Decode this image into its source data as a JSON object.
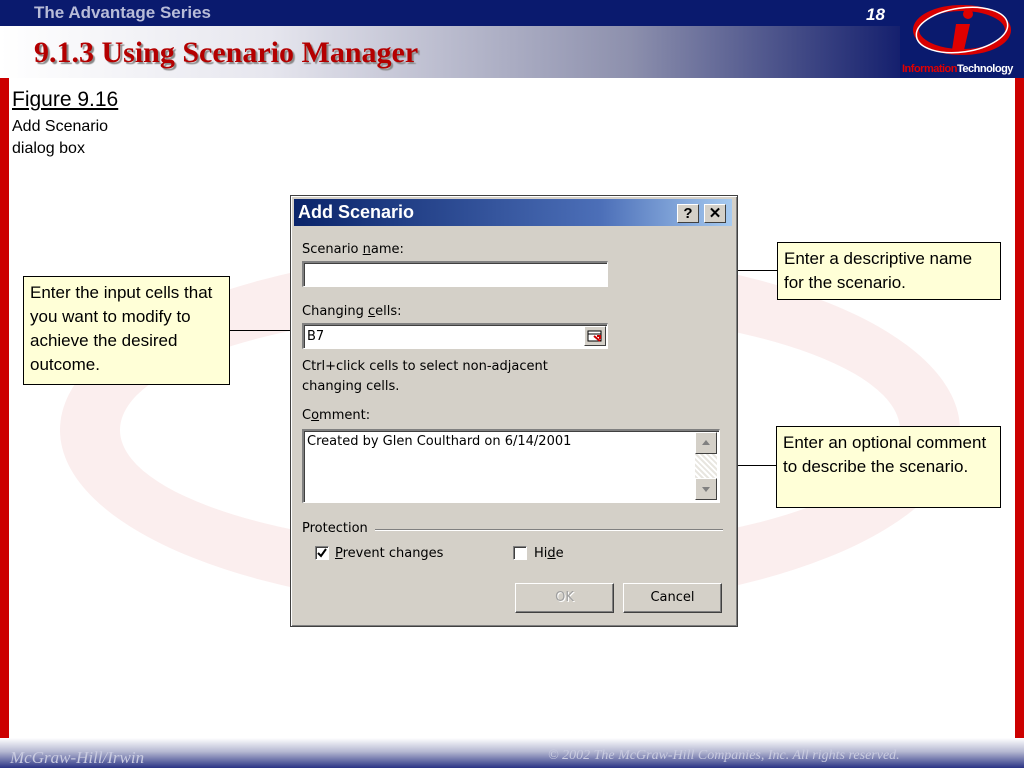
{
  "slide": {
    "series": "The Advantage Series",
    "page_number": "18",
    "title": "9.1.3 Using Scenario Manager",
    "logo_text_red": "Information",
    "logo_text_white": "Technology",
    "footer_left": "McGraw-Hill/Irwin",
    "footer_right": "© 2002  The McGraw-Hill Companies, Inc. All rights reserved."
  },
  "figure": {
    "title": "Figure 9.16",
    "subtitle": "Add Scenario dialog box"
  },
  "callouts": {
    "input_cells": "Enter the input cells that you want to modify to achieve the desired outcome.",
    "name": "Enter a descriptive name for the scenario.",
    "comment": "Enter an optional comment to describe the scenario."
  },
  "dialog": {
    "title": "Add Scenario",
    "help_label": "?",
    "close_label": "✕",
    "scenario_name_label_pre": "Scenario ",
    "scenario_name_label_key": "n",
    "scenario_name_label_post": "ame:",
    "scenario_name_value": "",
    "changing_cells_label_pre": "Changing ",
    "changing_cells_label_key": "c",
    "changing_cells_label_post": "ells:",
    "changing_cells_value": "B7",
    "hint_line1": "Ctrl+click cells to select non-adjacent",
    "hint_line2": "changing cells.",
    "comment_label_pre": "C",
    "comment_label_key": "o",
    "comment_label_post": "mment:",
    "comment_value": "Created by Glen Coulthard on 6/14/2001",
    "protection_label": "Protection",
    "prevent_changes_key": "P",
    "prevent_changes_rest": "revent changes",
    "prevent_changes_checked": true,
    "hide_pre": "Hi",
    "hide_key": "d",
    "hide_post": "e",
    "hide_checked": false,
    "ok_label": "OK",
    "cancel_label": "Cancel"
  },
  "colors": {
    "title_red": "#b40000",
    "callout_fill": "#ffffd7",
    "dialog_face": "#d4d0c8",
    "titlebar_blue": "#0a246a"
  }
}
